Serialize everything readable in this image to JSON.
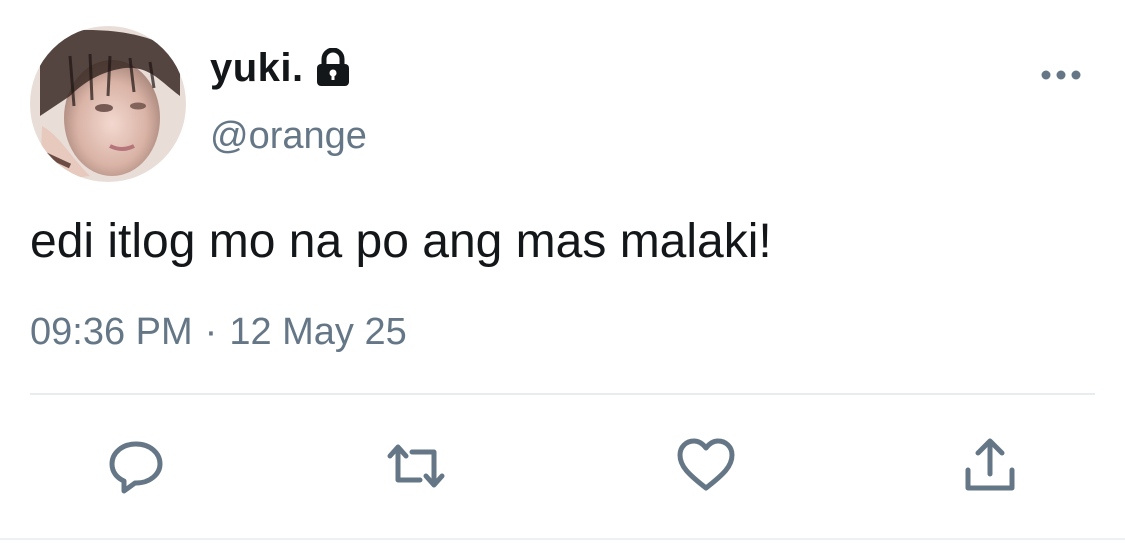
{
  "tweet": {
    "display_name": "yuki.",
    "handle": "@orange",
    "protected_icon": "lock-icon",
    "text": "edi itlog mo na po ang mas malaki!",
    "time": "09:36 PM",
    "separator": "·",
    "date": "12 May 25"
  },
  "actions": {
    "reply": "reply-icon",
    "retweet": "retweet-icon",
    "like": "heart-icon",
    "share": "share-icon"
  },
  "colors": {
    "text": "#14171a",
    "secondary": "#657786",
    "divider": "#e6ecf0"
  }
}
